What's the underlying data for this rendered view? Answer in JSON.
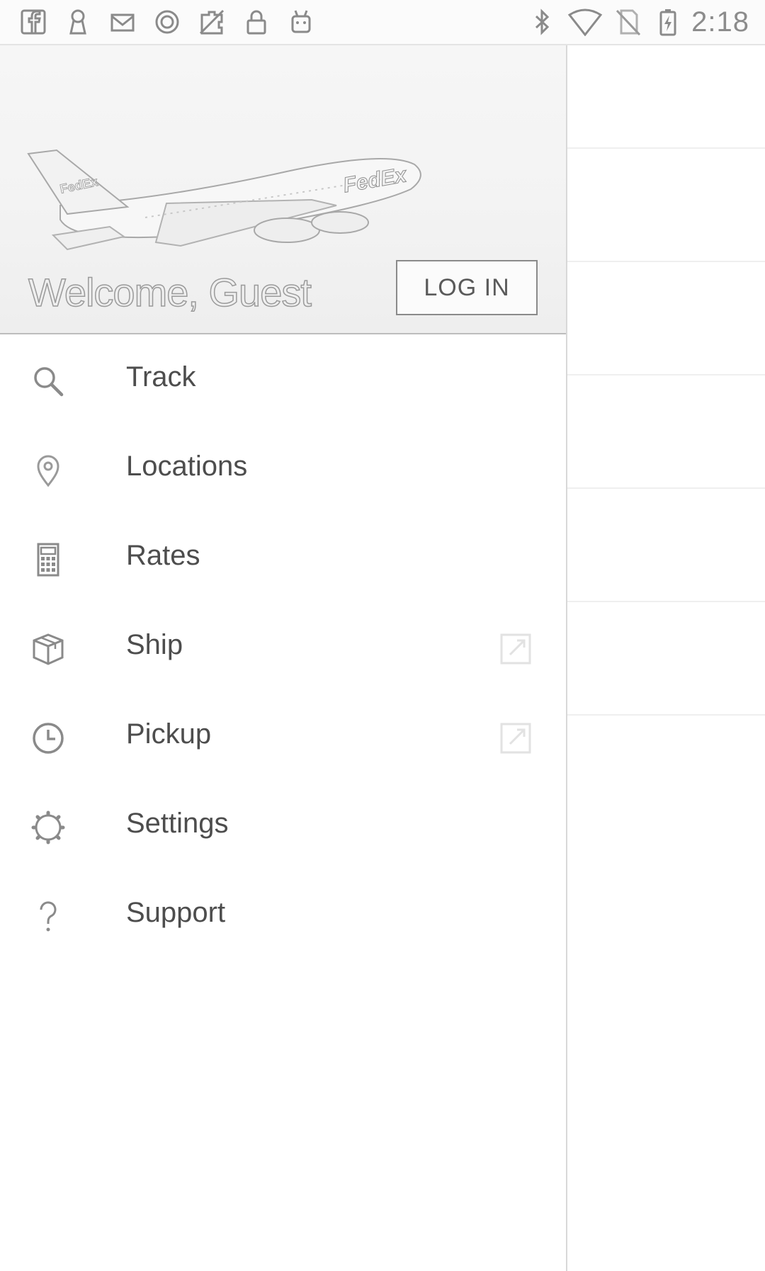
{
  "status_bar": {
    "time": "2:18",
    "left_icons": [
      "facebook-icon",
      "keyhole-icon",
      "mail-icon",
      "circle-o-icon",
      "no-sim-puzzle-icon",
      "lock-icon",
      "android-icon"
    ],
    "right_icons": [
      "bluetooth-icon",
      "wifi-icon",
      "no-sim-icon",
      "battery-charging-icon"
    ]
  },
  "drawer": {
    "header": {
      "welcome_text": "Welcome, Guest",
      "login_label": "LOG IN",
      "plane_brand": "FedEx"
    },
    "menu": [
      {
        "label": "Track",
        "icon": "search-icon",
        "external": false
      },
      {
        "label": "Locations",
        "icon": "location-pin-icon",
        "external": false
      },
      {
        "label": "Rates",
        "icon": "calculator-icon",
        "external": false
      },
      {
        "label": "Ship",
        "icon": "package-icon",
        "external": true
      },
      {
        "label": "Pickup",
        "icon": "clock-icon",
        "external": true
      },
      {
        "label": "Settings",
        "icon": "gear-icon",
        "external": false
      },
      {
        "label": "Support",
        "icon": "question-icon",
        "external": false
      }
    ]
  },
  "colors": {
    "text": "#4d4d4d",
    "icon": "#8a8a8a",
    "divider": "#d8d8d8"
  }
}
